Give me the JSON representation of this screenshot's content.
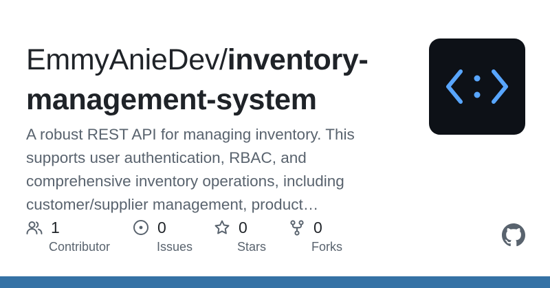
{
  "repo": {
    "owner": "EmmyAnieDev/",
    "name_line1": "inventory-",
    "name_line2": "management-system",
    "description": "A robust REST API for managing inventory. This supports user authentication, RBAC, and comprehensive inventory operations, including customer/supplier management, product…"
  },
  "stats": [
    {
      "icon": "people-icon",
      "count": "1",
      "label": "Contributor"
    },
    {
      "icon": "issue-circle-icon",
      "count": "0",
      "label": "Issues"
    },
    {
      "icon": "star-icon",
      "count": "0",
      "label": "Stars"
    },
    {
      "icon": "fork-icon",
      "count": "0",
      "label": "Forks"
    }
  ],
  "colors": {
    "text": "#1f2328",
    "muted": "#59636e",
    "logo_bg": "#0d1117",
    "logo_glyph": "#58a6ff",
    "bottom_bar": "#3572a5"
  },
  "icons": {
    "repo_logo": "code-brackets-icon",
    "brand": "github-octocat-icon"
  }
}
